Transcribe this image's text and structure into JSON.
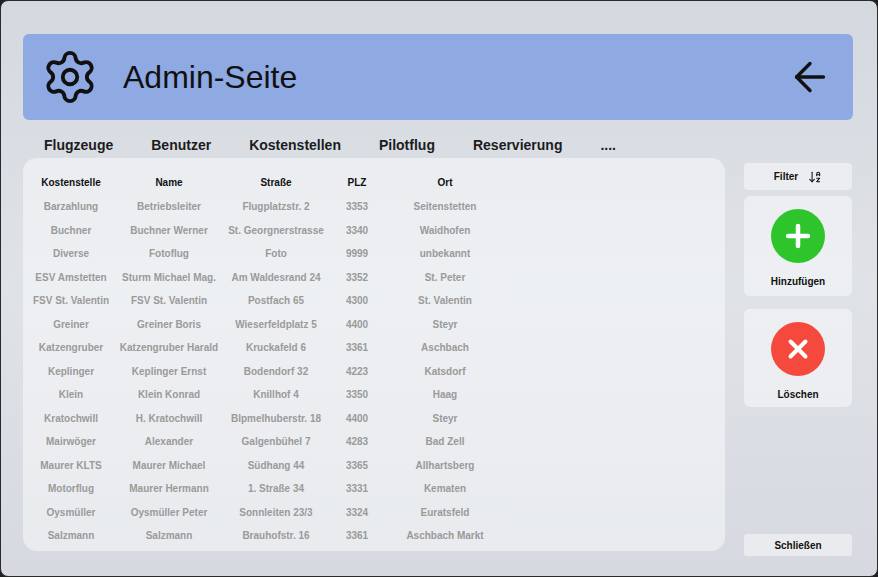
{
  "window": {
    "title": "Admin-Seite"
  },
  "tabs": [
    {
      "label": "Flugzeuge",
      "selected": false
    },
    {
      "label": "Benutzer",
      "selected": false
    },
    {
      "label": "Kostenstellen",
      "selected": false
    },
    {
      "label": "Pilotflug",
      "selected": false
    },
    {
      "label": "Reservierung",
      "selected": false
    },
    {
      "label": "....",
      "selected": false
    }
  ],
  "table": {
    "columns": [
      "Kostenstelle",
      "Name",
      "Straße",
      "PLZ",
      "Ort"
    ],
    "rows": [
      [
        "Barzahlung",
        "Betriebsleiter",
        "Flugplatzstr. 2",
        "3353",
        "Seitenstetten"
      ],
      [
        "Buchner",
        "Buchner Werner",
        "St. Georgnerstrasse",
        "3340",
        "Waidhofen"
      ],
      [
        "Diverse",
        "Fotoflug",
        "Foto",
        "9999",
        "unbekannt"
      ],
      [
        "ESV Amstetten",
        "Sturm Michael Mag.",
        "Am Waldesrand 24",
        "3352",
        "St. Peter"
      ],
      [
        "FSV St. Valentin",
        "FSV St. Valentin",
        "Postfach 65",
        "4300",
        "St. Valentin"
      ],
      [
        "Greiner",
        "Greiner Boris",
        "Wieserfeldplatz 5",
        "4400",
        "Steyr"
      ],
      [
        "Katzengruber",
        "Katzengruber Harald",
        "Kruckafeld 6",
        "3361",
        "Aschbach"
      ],
      [
        "Keplinger",
        "Keplinger Ernst",
        "Bodendorf 32",
        "4223",
        "Katsdorf"
      ],
      [
        "Klein",
        "Klein Konrad",
        "Knillhof 4",
        "3350",
        "Haag"
      ],
      [
        "Kratochwill",
        "H. Kratochwill",
        "Blpmelhuberstr. 18",
        "4400",
        "Steyr"
      ],
      [
        "Mairwöger",
        "Alexander",
        "Galgenbühel 7",
        "4283",
        "Bad Zell"
      ],
      [
        "Maurer KLTS",
        "Maurer Michael",
        "Südhang 44",
        "3365",
        "Allhartsberg"
      ],
      [
        "Motorflug",
        "Maurer Hermann",
        "1. Straße 34",
        "3331",
        "Kematen"
      ],
      [
        "Oysmüller",
        "Oysmüller Peter",
        "Sonnleiten 23/3",
        "3324",
        "Euratsfeld"
      ],
      [
        "Salzmann",
        "Salzmann",
        "Brauhofstr. 16",
        "3361",
        "Aschbach Markt"
      ]
    ]
  },
  "filter": {
    "label": "Filter"
  },
  "actions": [
    {
      "label": "Hinzufügen",
      "kind": "add",
      "color": "#2ec42b"
    },
    {
      "label": "Löschen",
      "kind": "delete",
      "color": "#f4493c"
    }
  ],
  "close_button": {
    "label": "Schließen"
  }
}
